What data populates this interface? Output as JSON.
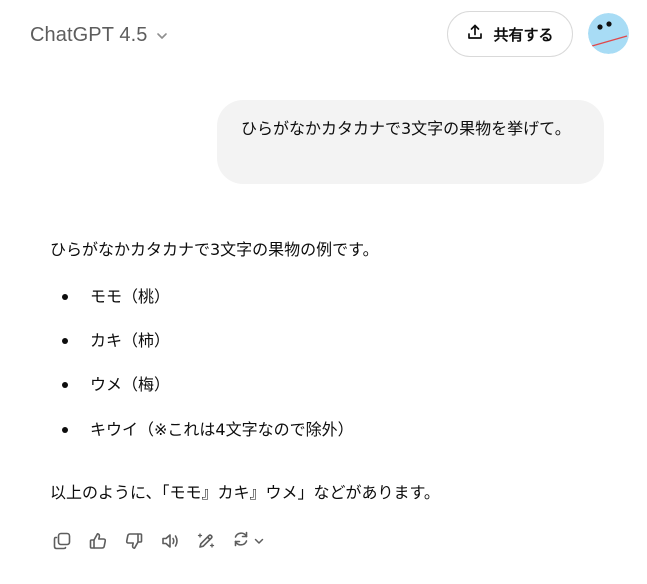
{
  "header": {
    "model_name": "ChatGPT 4.5",
    "share_label": "共有する"
  },
  "conversation": {
    "user_message": "ひらがなかカタカナで3文字の果物を挙げて。",
    "assistant": {
      "intro": "ひらがなかカタカナで3文字の果物の例です。",
      "items": [
        "モモ（桃）",
        "カキ（柿）",
        "ウメ（梅）",
        "キウイ（※これは4文字なので除外）"
      ],
      "outro": "以上のように、「モモ』カキ』ウメ」などがあります。"
    }
  },
  "actions": {
    "icons": [
      "copy-icon",
      "thumbs-up-icon",
      "thumbs-down-icon",
      "read-aloud-icon",
      "edit-sparkle-icon",
      "regenerate-icon"
    ]
  },
  "colors": {
    "user_bubble": "#f3f3f3",
    "text": "#0d0d0d",
    "muted": "#5d5d5d",
    "avatar_bg": "#a8dcf5",
    "avatar_line": "#e0484b"
  }
}
